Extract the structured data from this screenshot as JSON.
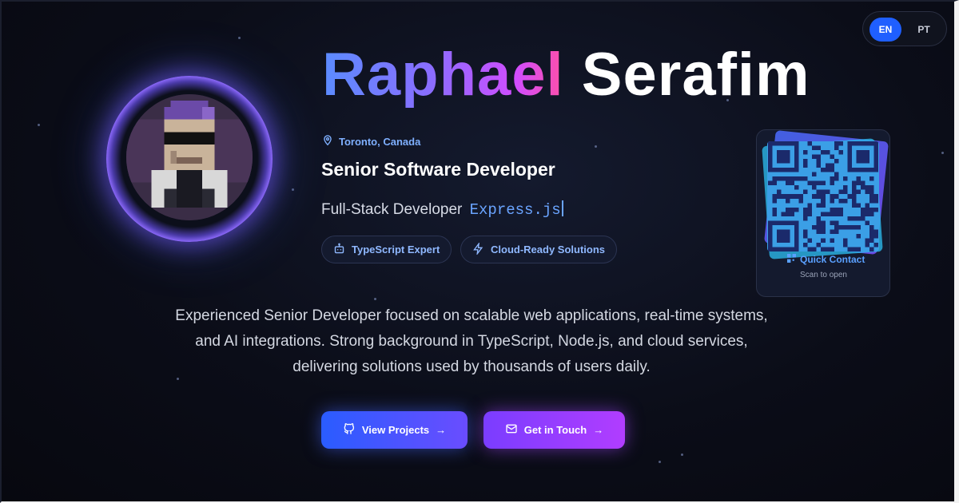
{
  "lang_toggle": {
    "en": "EN",
    "pt": "PT"
  },
  "hero": {
    "name_first": "Raphael",
    "name_last": "Serafim",
    "location": "Toronto, Canada",
    "title": "Senior Software Developer",
    "subtitle_prefix": "Full-Stack Developer",
    "subtitle_typed": "Express.js",
    "chips": [
      "TypeScript Expert",
      "Cloud-Ready Solutions"
    ],
    "description": "Experienced Senior Developer focused on scalable web applications, real-time systems, and AI integrations. Strong background in TypeScript, Node.js, and cloud services, delivering solutions used by thousands of users daily."
  },
  "qr": {
    "label": "Quick Contact",
    "hint": "Scan to open"
  },
  "buttons": {
    "projects": "View Projects",
    "contact": "Get in Touch",
    "arrow": "→"
  },
  "colors": {
    "accent_blue": "#1f5fff",
    "accent_purple": "#8a6dff",
    "accent_pink": "#ff4fa8"
  },
  "icons": [
    "map-pin-icon",
    "bot-icon",
    "zap-icon",
    "qr-code-icon",
    "github-icon",
    "mail-icon",
    "arrow-right-icon"
  ]
}
